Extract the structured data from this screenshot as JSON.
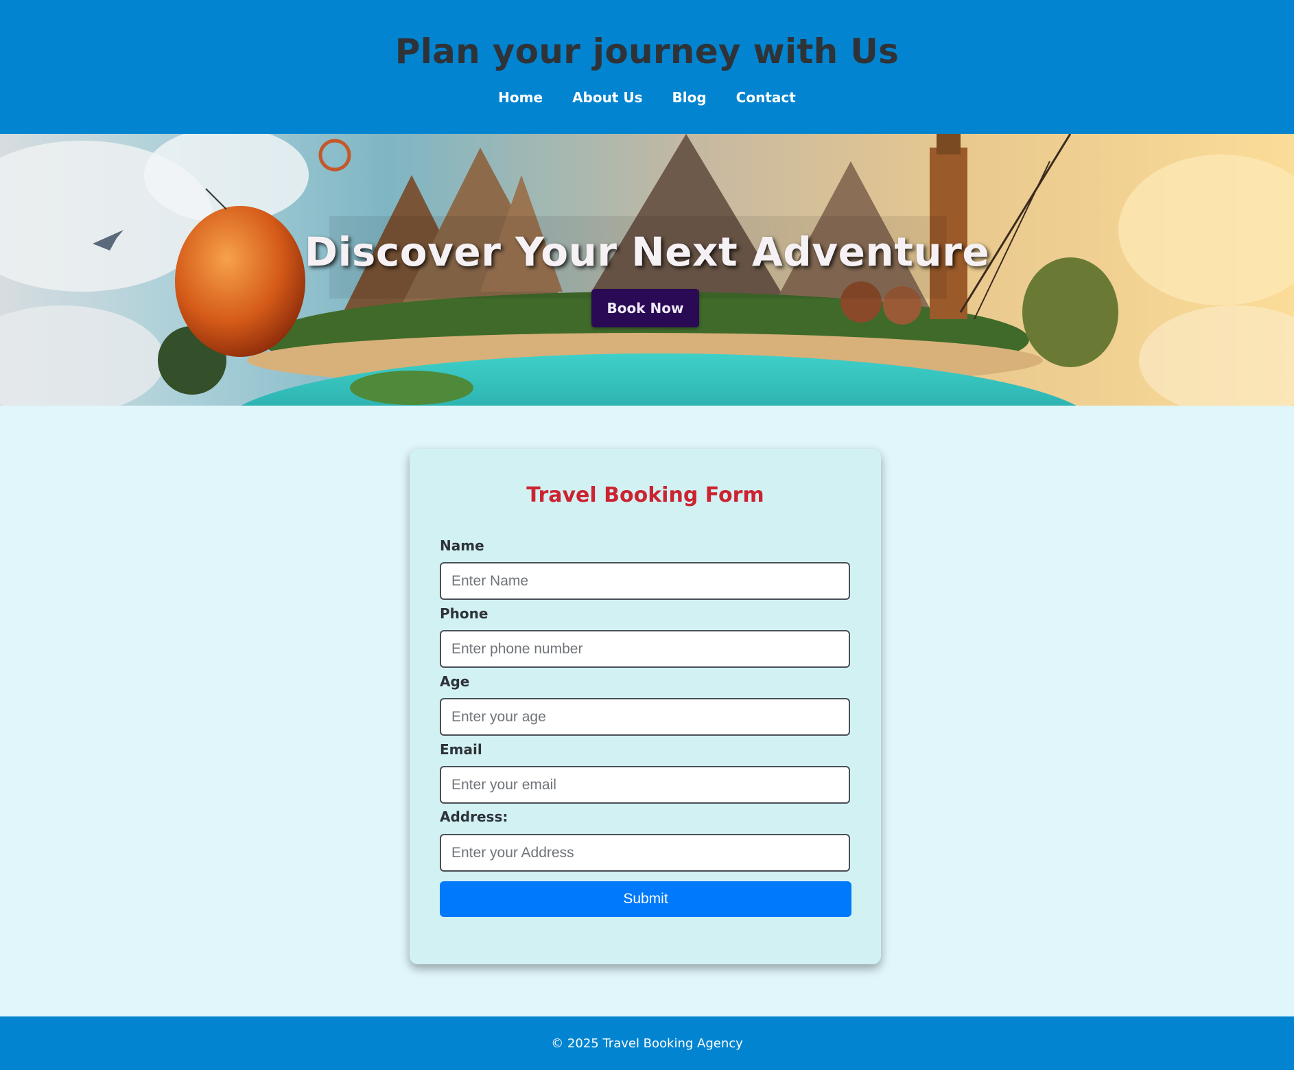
{
  "header": {
    "title": "Plan your journey with Us",
    "nav": [
      {
        "label": "Home"
      },
      {
        "label": "About Us"
      },
      {
        "label": "Blog"
      },
      {
        "label": "Contact"
      }
    ]
  },
  "hero": {
    "title": "Discover Your Next Adventure",
    "button_label": "Book Now",
    "image_name": "travel-collage-hero-image"
  },
  "form": {
    "title": "Travel Booking Form",
    "fields": [
      {
        "label": "Name",
        "placeholder": "Enter Name",
        "value": ""
      },
      {
        "label": "Phone",
        "placeholder": "Enter phone number",
        "value": ""
      },
      {
        "label": "Age",
        "placeholder": "Enter your age",
        "value": ""
      },
      {
        "label": "Email",
        "placeholder": "Enter your email",
        "value": ""
      },
      {
        "label": "Address:",
        "placeholder": "Enter your Address",
        "value": ""
      }
    ],
    "submit_label": "Submit"
  },
  "footer": {
    "text": "© 2025 Travel Booking Agency"
  },
  "colors": {
    "header_bg": "#0284d0",
    "page_bg": "#e0f6fa",
    "card_bg": "#d2f1f3",
    "form_title": "#cc2330",
    "submit_bg": "#0179fb",
    "book_now_bg": "#2a0a54"
  }
}
